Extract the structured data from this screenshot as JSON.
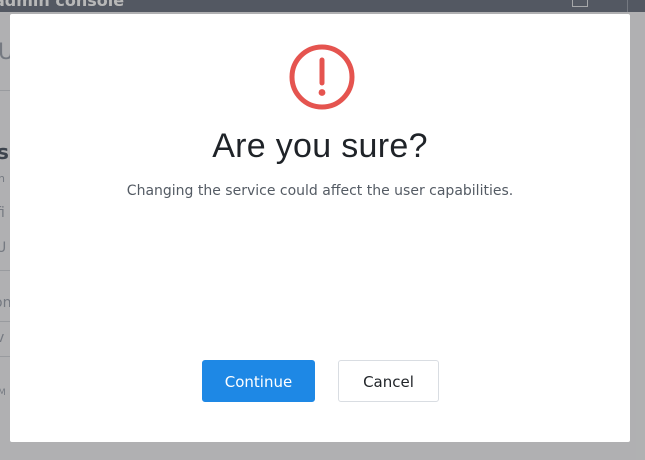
{
  "background": {
    "app_title": "admin console",
    "fragments": [
      "U",
      "s",
      "n",
      "fi",
      "U",
      "on",
      "v",
      "M"
    ]
  },
  "dialog": {
    "icon": "exclamation-circle-icon",
    "icon_color": "#e5544f",
    "title": "Are you sure?",
    "message": "Changing the service could affect the user capabilities.",
    "buttons": {
      "continue_label": "Continue",
      "cancel_label": "Cancel"
    },
    "colors": {
      "primary": "#1e88e5",
      "title_text": "#1f2328",
      "message_text": "#545b64"
    }
  }
}
